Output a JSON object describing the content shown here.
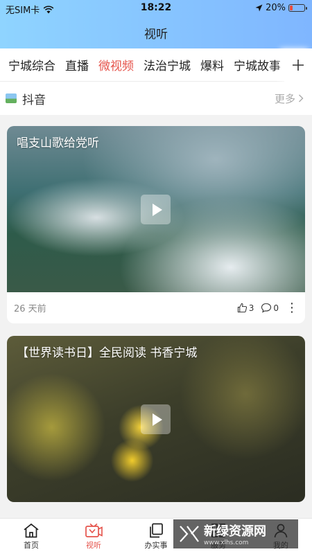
{
  "status": {
    "carrier": "无SIM卡",
    "time": "18:22",
    "battery": "20%",
    "battery_level": 0.2
  },
  "header": {
    "title": "视听"
  },
  "tabs": {
    "items": [
      "宁城综合",
      "直播",
      "微视频",
      "法治宁城",
      "爆料",
      "宁城故事"
    ],
    "active_index": 2,
    "add_icon": "plus-icon"
  },
  "section": {
    "label": "抖音",
    "more": "更多"
  },
  "feed": [
    {
      "caption": "唱支山歌给党听",
      "time": "26 天前",
      "likes": "3",
      "comments": "0"
    },
    {
      "caption": "【世界读书日】全民阅读 书香宁城",
      "time": "",
      "likes": "",
      "comments": ""
    }
  ],
  "tabbar": {
    "items": [
      "首页",
      "视听",
      "办实事",
      "服务",
      "我的"
    ],
    "active_index": 1
  },
  "watermark": {
    "main": "新绿资源网",
    "sub": "www.xlhs.com"
  },
  "colors": {
    "accent": "#e5534b",
    "header_from": "#8fd4ff",
    "header_to": "#7fb6ff"
  }
}
